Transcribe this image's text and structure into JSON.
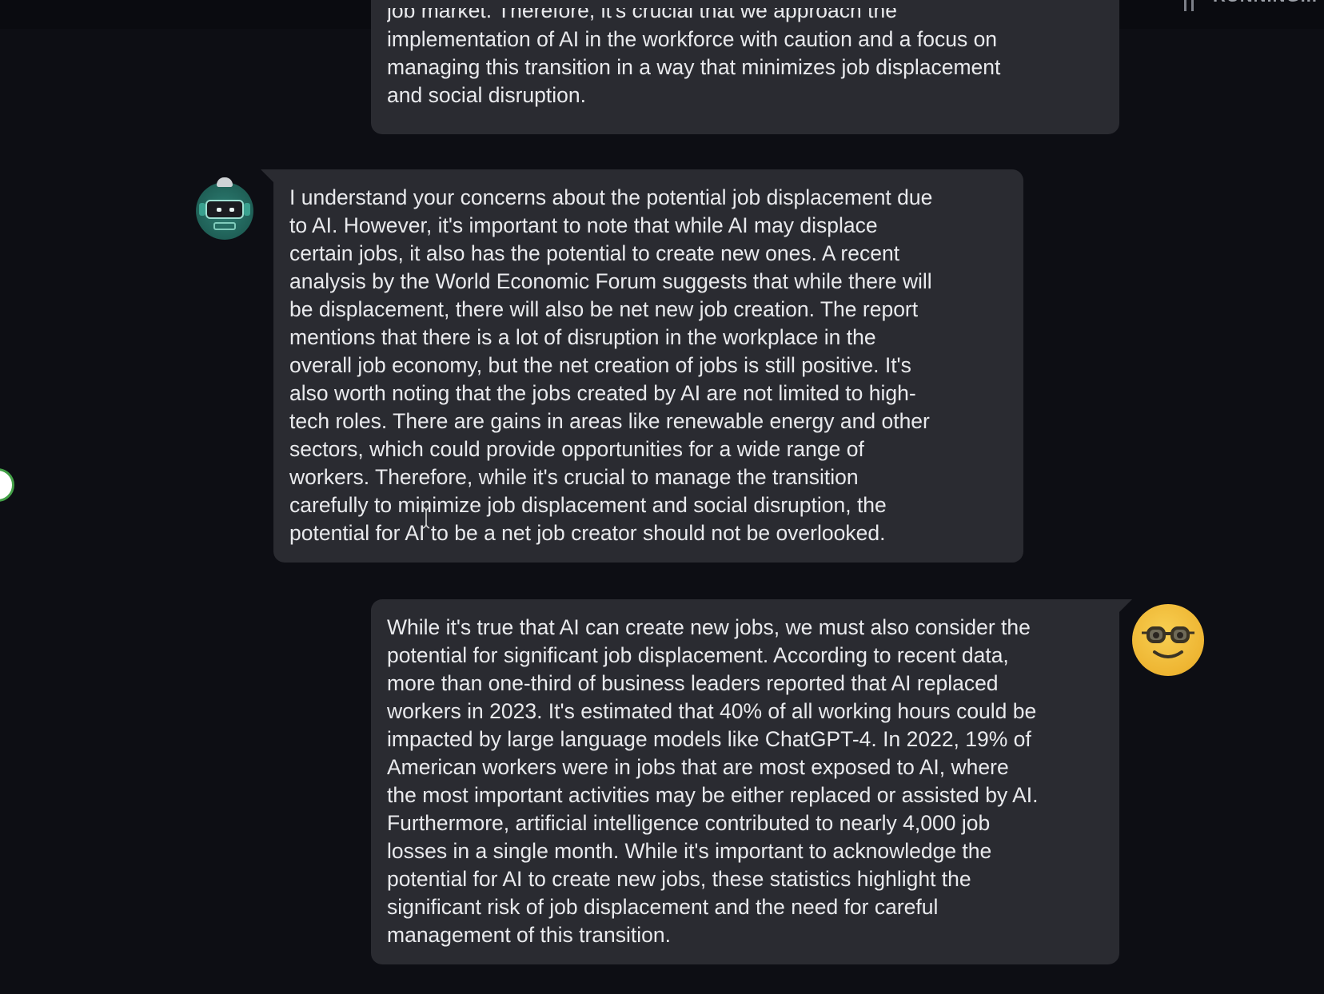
{
  "status": {
    "running_text": "RUNNING..."
  },
  "messages": [
    {
      "role": "user",
      "partial_first_line": "job market. Therefore, it's crucial that we approach the",
      "lines": [
        "implementation of AI in the workforce with caution and a focus on",
        "managing this transition in a way that minimizes job displacement",
        "and social disruption."
      ]
    },
    {
      "role": "assistant",
      "lines": [
        "I understand your concerns about the potential job displacement due",
        "to AI. However, it's important to note that while AI may displace",
        "certain jobs, it also has the potential to create new ones. A recent",
        "analysis by the World Economic Forum suggests that while there will",
        "be displacement, there will also be net new job creation. The report",
        "mentions that there is a lot of disruption in the workplace in the",
        "overall job economy, but the net creation of jobs is still positive. It's",
        "also worth noting that the jobs created by AI are not limited to high-",
        "tech roles. There are gains in areas like renewable energy and other",
        "sectors, which could provide opportunities for a wide range of",
        "workers. Therefore, while it's crucial to manage the transition",
        "carefully to minimize job displacement and social disruption, the",
        "potential for AI to be a net job creator should not be overlooked."
      ]
    },
    {
      "role": "user",
      "lines": [
        "While it's true that AI can create new jobs, we must also consider the",
        "potential for significant job displacement. According to recent data,",
        "more than one-third of business leaders reported that AI replaced",
        "workers in 2023. It's estimated that 40% of all working hours could be",
        "impacted by large language models like ChatGPT-4. In 2022, 19% of",
        "American workers were in jobs that are most exposed to AI, where",
        "the most important activities may be either replaced or assisted by AI.",
        "Furthermore, artificial intelligence contributed to nearly 4,000 job",
        "losses in a single month. While it's important to acknowledge the",
        "potential for AI to create new jobs, these statistics highlight the",
        "significant risk of job displacement and the need for careful",
        "management of this transition."
      ]
    }
  ],
  "avatars": {
    "assistant_icon": "robot-avatar-icon",
    "user_icon": "nerd-face-avatar-icon"
  },
  "colors": {
    "background": "#0d0e14",
    "bubble": "#2a2b31",
    "text": "#e9eaed",
    "assistant_avatar": "#2d7e73",
    "user_avatar": "#f4c542",
    "handle_border": "#43a047"
  }
}
